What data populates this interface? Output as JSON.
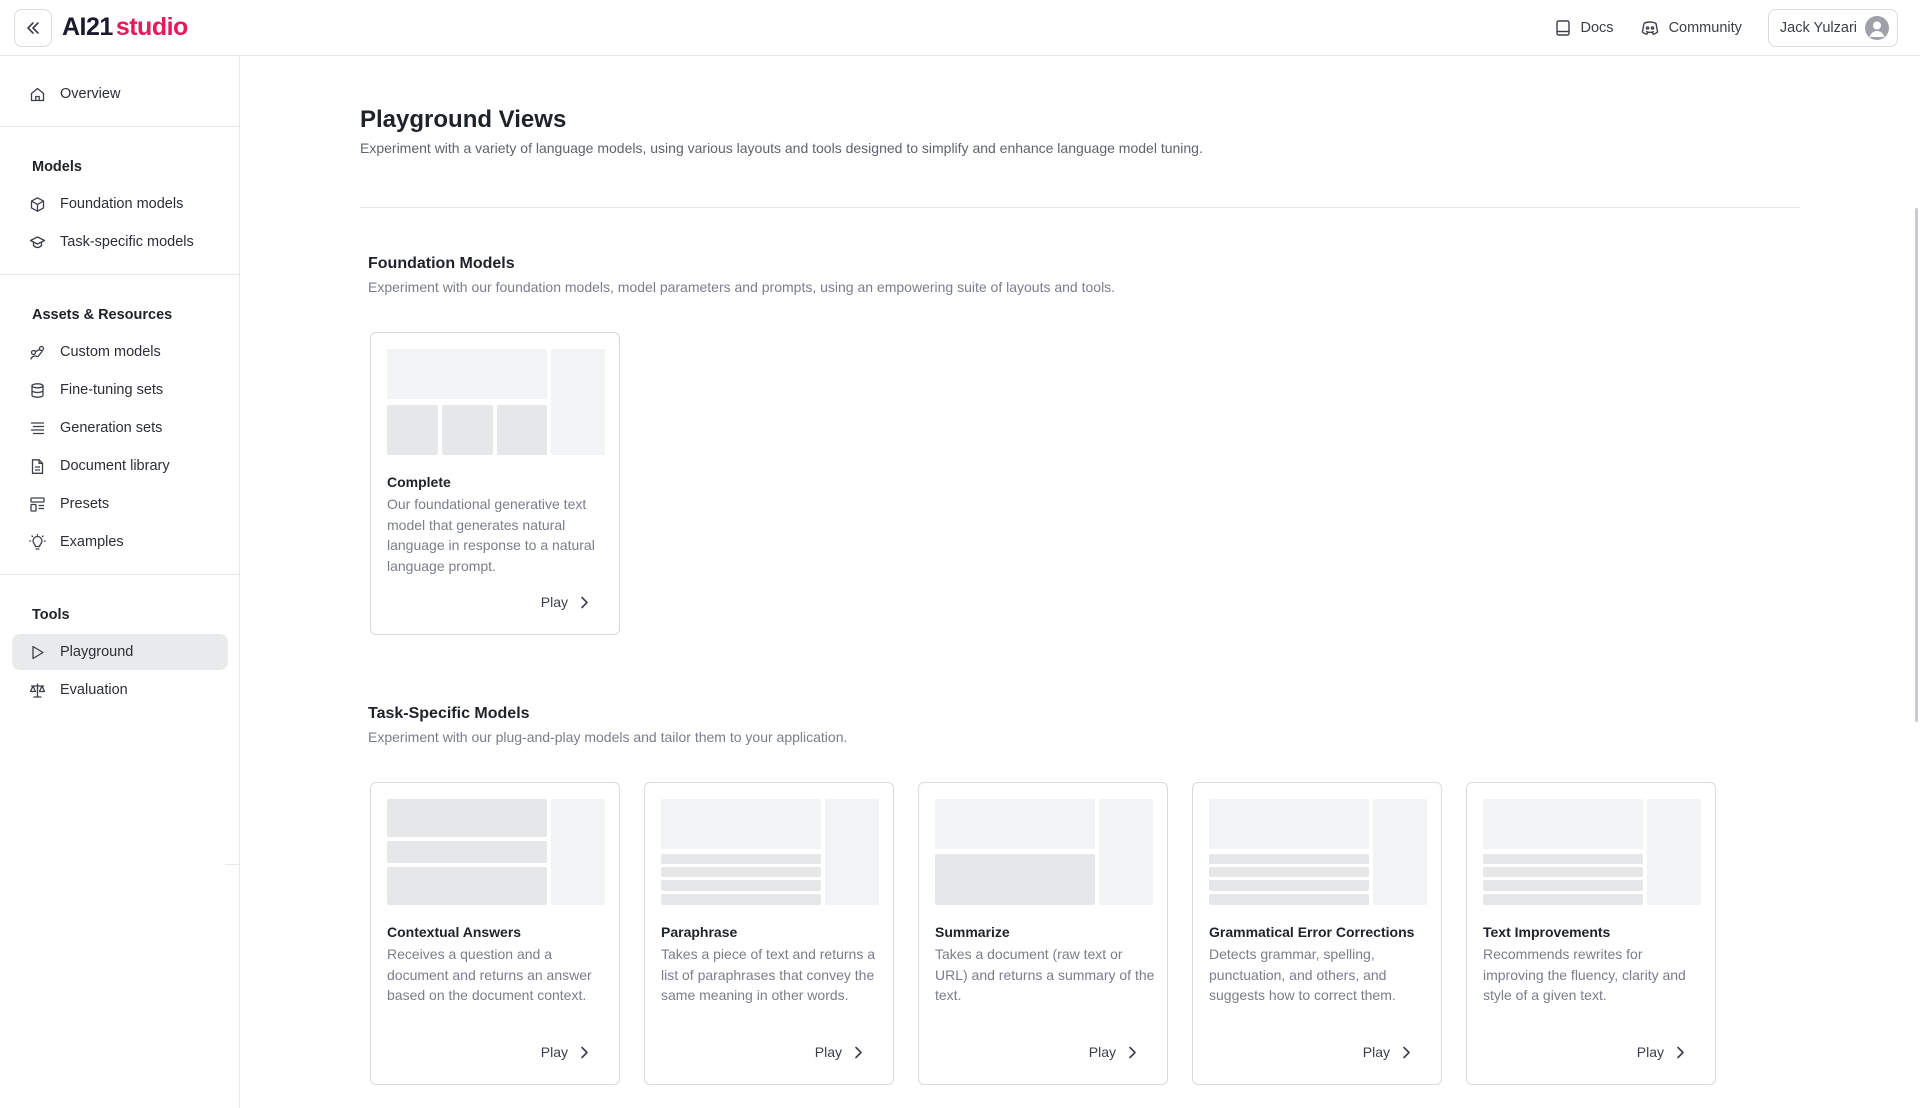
{
  "header": {
    "logo_ai": "AI21",
    "logo_studio": "studio",
    "docs_label": "Docs",
    "community_label": "Community",
    "user_name": "Jack Yulzari"
  },
  "sidebar": {
    "overview": "Overview",
    "models_title": "Models",
    "foundation_models": "Foundation models",
    "task_specific_models": "Task-specific models",
    "assets_title": "Assets & Resources",
    "custom_models": "Custom models",
    "fine_tuning_sets": "Fine-tuning sets",
    "generation_sets": "Generation sets",
    "document_library": "Document library",
    "presets": "Presets",
    "examples": "Examples",
    "tools_title": "Tools",
    "playground": "Playground",
    "evaluation": "Evaluation"
  },
  "main": {
    "title": "Playground Views",
    "subtitle": "Experiment with a variety of language models, using various layouts and tools designed to simplify and enhance language model tuning.",
    "foundation": {
      "title": "Foundation Models",
      "subtitle": "Experiment with our foundation models, model parameters and prompts, using an empowering suite of layouts and tools.",
      "cards": [
        {
          "title": "Complete",
          "desc": "Our foundational generative text model that generates natural language in response to a natural language prompt.",
          "play": "Play"
        }
      ]
    },
    "task": {
      "title": "Task-Specific Models",
      "subtitle": "Experiment with our plug-and-play models and tailor them to your application.",
      "cards": [
        {
          "title": "Contextual Answers",
          "desc": "Receives a question and a document and returns an answer based on the document context.",
          "play": "Play"
        },
        {
          "title": "Paraphrase",
          "desc": "Takes a piece of text and returns a list of paraphrases that convey the same meaning in other words.",
          "play": "Play"
        },
        {
          "title": "Summarize",
          "desc": "Takes a document (raw text or URL) and returns a summary of the text.",
          "play": "Play"
        },
        {
          "title": "Grammatical Error Corrections",
          "desc": "Detects grammar, spelling, punctuation, and others, and suggests how to correct them.",
          "play": "Play"
        },
        {
          "title": "Text Improvements",
          "desc": "Recommends rewrites for improving the fluency, clarity and style of a given text.",
          "play": "Play"
        }
      ]
    }
  },
  "colors": {
    "brand": "#e6195a",
    "active_bg": "#e9eaec",
    "border": "#d8dadd"
  }
}
